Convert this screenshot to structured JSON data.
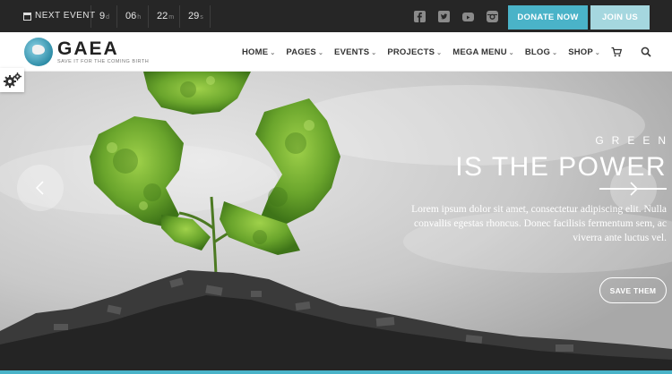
{
  "topbar": {
    "next_event_label": "NEXT EVENT",
    "countdown": [
      {
        "value": "9",
        "unit": "d"
      },
      {
        "value": "06",
        "unit": "h"
      },
      {
        "value": "22",
        "unit": "m"
      },
      {
        "value": "29",
        "unit": "s"
      }
    ],
    "social_icons": [
      "facebook-icon",
      "twitter-icon",
      "youtube-icon",
      "instagram-icon"
    ],
    "donate_label": "DONATE NOW",
    "join_label": "JOIN US"
  },
  "header": {
    "logo_name": "GAEA",
    "logo_tagline": "SAVE IT FOR THE COMING BIRTH",
    "nav": [
      "HOME",
      "PAGES",
      "EVENTS",
      "PROJECTS",
      "MEGA MENU",
      "BLOG",
      "SHOP"
    ]
  },
  "hero": {
    "caption_small": "GREEN",
    "caption_big": "IS THE POWER",
    "caption_text": "Lorem ipsum dolor sit amet, consectetur adipiscing elit. Nulla convallis egestas rhoncus. Donec facilisis fermentum sem, ac viverra ante luctus vel.",
    "button_label": "SAVE THEM"
  },
  "colors": {
    "accent": "#4ab3c8",
    "accent_light": "#a5d7df",
    "topbar_bg": "#262626",
    "leaf_green": "#6aa52c"
  }
}
